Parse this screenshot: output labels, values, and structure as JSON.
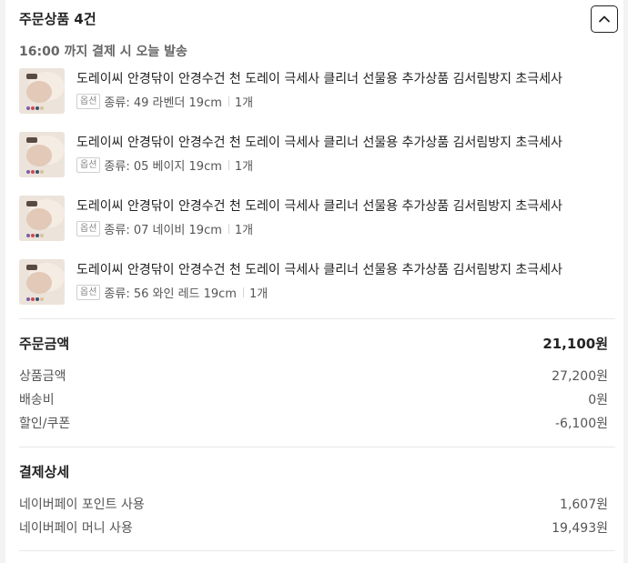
{
  "header": {
    "title": "주문상품 4건"
  },
  "shipping_note": "16:00 까지 결제 시 오늘 발송",
  "items": [
    {
      "name": "도레이씨 안경닦이 안경수건 천 도레이 극세사 클리너 선물용 추가상품 김서림방지 초극세사",
      "badge": "옵션",
      "option": "종류: 49 라벤더 19cm",
      "qty": "1개"
    },
    {
      "name": "도레이씨 안경닦이 안경수건 천 도레이 극세사 클리너 선물용 추가상품 김서림방지 초극세사",
      "badge": "옵션",
      "option": "종류: 05 베이지 19cm",
      "qty": "1개"
    },
    {
      "name": "도레이씨 안경닦이 안경수건 천 도레이 극세사 클리너 선물용 추가상품 김서림방지 초극세사",
      "badge": "옵션",
      "option": "종류: 07 네이비 19cm",
      "qty": "1개"
    },
    {
      "name": "도레이씨 안경닦이 안경수건 천 도레이 극세사 클리너 선물용 추가상품 김서림방지 초극세사",
      "badge": "옵션",
      "option": "종류: 56 와인 레드 19cm",
      "qty": "1개"
    }
  ],
  "order_amount": {
    "title": "주문금액",
    "total": "21,100원",
    "rows": [
      {
        "label": "상품금액",
        "value": "27,200원"
      },
      {
        "label": "배송비",
        "value": "0원"
      },
      {
        "label": "할인/쿠폰",
        "value": "-6,100원"
      }
    ]
  },
  "payment_detail": {
    "title": "결제상세",
    "rows": [
      {
        "label": "네이버페이 포인트 사용",
        "value": "1,607원"
      },
      {
        "label": "네이버페이 머니 사용",
        "value": "19,493원"
      }
    ]
  },
  "icons": {
    "collapse": "chevron-up-icon",
    "thumbnail": "product-thumbnail-image"
  }
}
